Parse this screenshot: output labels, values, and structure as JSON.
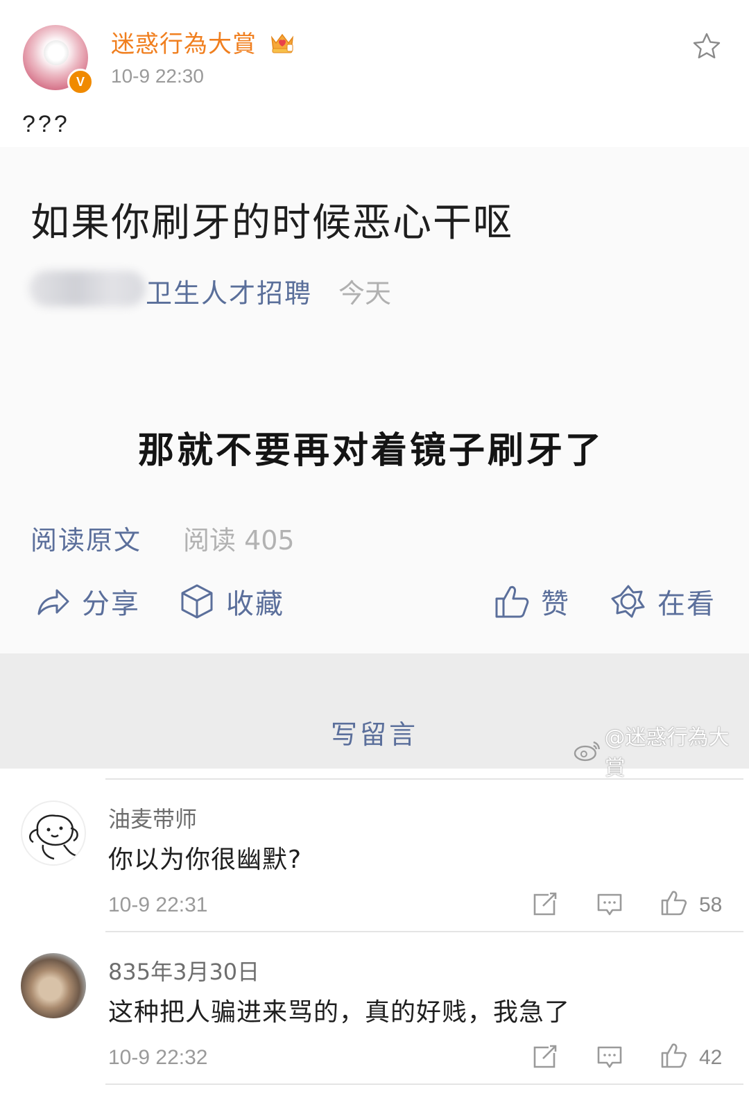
{
  "header": {
    "username": "迷惑行為大賞",
    "time": "10-9 22:30",
    "badge": "V",
    "badge_icon": "verified-v-icon",
    "crown_icon": "crown-icon",
    "star_icon": "star-icon",
    "accent_color": "#f07f1f"
  },
  "post": {
    "text": "???"
  },
  "card": {
    "title": "如果你刷牙的时候恶心干呕",
    "source_name": "卫生人才招聘",
    "source_time": "今天",
    "punchline": "那就不要再对着镜子刷牙了",
    "read_original": "阅读原文",
    "read_count": "阅读 405",
    "actions": {
      "share": "分享",
      "favorite": "收藏",
      "like": "赞",
      "watching": "在看"
    },
    "link_color": "#5b6f9b"
  },
  "comment_bar": {
    "write": "写留言",
    "watermark": "@迷惑行為大賞"
  },
  "comments": [
    {
      "name": "油麦带师",
      "text": "你以为你很幽默?",
      "time": "10-9 22:31",
      "likes": "58"
    },
    {
      "name": "835年3月30日",
      "text": "这种把人骗进来骂的，真的好贱，我急了",
      "time": "10-9 22:32",
      "likes": "42"
    }
  ]
}
